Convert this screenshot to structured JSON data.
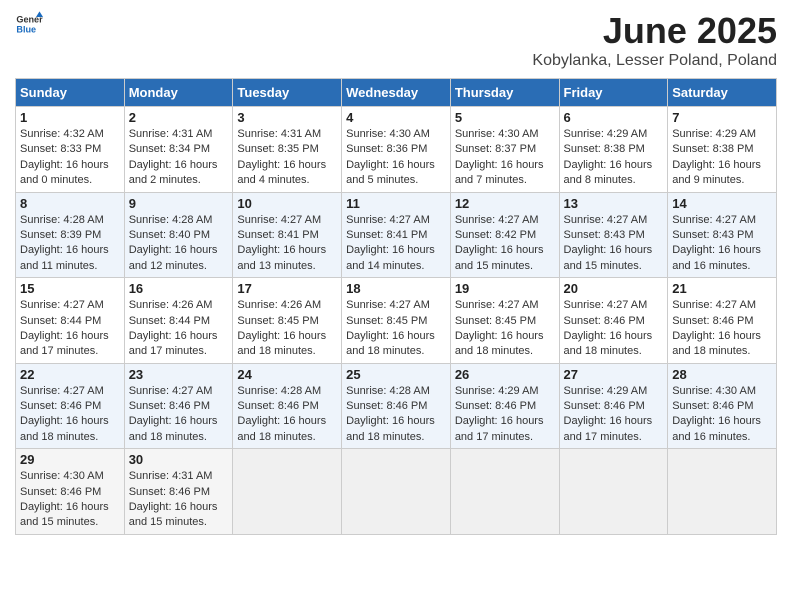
{
  "logo": {
    "general": "General",
    "blue": "Blue"
  },
  "title": "June 2025",
  "location": "Kobylanka, Lesser Poland, Poland",
  "weekdays": [
    "Sunday",
    "Monday",
    "Tuesday",
    "Wednesday",
    "Thursday",
    "Friday",
    "Saturday"
  ],
  "weeks": [
    [
      {
        "day": 1,
        "sunrise": "4:32 AM",
        "sunset": "8:33 PM",
        "daylight": "16 hours and 0 minutes."
      },
      {
        "day": 2,
        "sunrise": "4:31 AM",
        "sunset": "8:34 PM",
        "daylight": "16 hours and 2 minutes."
      },
      {
        "day": 3,
        "sunrise": "4:31 AM",
        "sunset": "8:35 PM",
        "daylight": "16 hours and 4 minutes."
      },
      {
        "day": 4,
        "sunrise": "4:30 AM",
        "sunset": "8:36 PM",
        "daylight": "16 hours and 5 minutes."
      },
      {
        "day": 5,
        "sunrise": "4:30 AM",
        "sunset": "8:37 PM",
        "daylight": "16 hours and 7 minutes."
      },
      {
        "day": 6,
        "sunrise": "4:29 AM",
        "sunset": "8:38 PM",
        "daylight": "16 hours and 8 minutes."
      },
      {
        "day": 7,
        "sunrise": "4:29 AM",
        "sunset": "8:38 PM",
        "daylight": "16 hours and 9 minutes."
      }
    ],
    [
      {
        "day": 8,
        "sunrise": "4:28 AM",
        "sunset": "8:39 PM",
        "daylight": "16 hours and 11 minutes."
      },
      {
        "day": 9,
        "sunrise": "4:28 AM",
        "sunset": "8:40 PM",
        "daylight": "16 hours and 12 minutes."
      },
      {
        "day": 10,
        "sunrise": "4:27 AM",
        "sunset": "8:41 PM",
        "daylight": "16 hours and 13 minutes."
      },
      {
        "day": 11,
        "sunrise": "4:27 AM",
        "sunset": "8:41 PM",
        "daylight": "16 hours and 14 minutes."
      },
      {
        "day": 12,
        "sunrise": "4:27 AM",
        "sunset": "8:42 PM",
        "daylight": "16 hours and 15 minutes."
      },
      {
        "day": 13,
        "sunrise": "4:27 AM",
        "sunset": "8:43 PM",
        "daylight": "16 hours and 15 minutes."
      },
      {
        "day": 14,
        "sunrise": "4:27 AM",
        "sunset": "8:43 PM",
        "daylight": "16 hours and 16 minutes."
      }
    ],
    [
      {
        "day": 15,
        "sunrise": "4:27 AM",
        "sunset": "8:44 PM",
        "daylight": "16 hours and 17 minutes."
      },
      {
        "day": 16,
        "sunrise": "4:26 AM",
        "sunset": "8:44 PM",
        "daylight": "16 hours and 17 minutes."
      },
      {
        "day": 17,
        "sunrise": "4:26 AM",
        "sunset": "8:45 PM",
        "daylight": "16 hours and 18 minutes."
      },
      {
        "day": 18,
        "sunrise": "4:27 AM",
        "sunset": "8:45 PM",
        "daylight": "16 hours and 18 minutes."
      },
      {
        "day": 19,
        "sunrise": "4:27 AM",
        "sunset": "8:45 PM",
        "daylight": "16 hours and 18 minutes."
      },
      {
        "day": 20,
        "sunrise": "4:27 AM",
        "sunset": "8:46 PM",
        "daylight": "16 hours and 18 minutes."
      },
      {
        "day": 21,
        "sunrise": "4:27 AM",
        "sunset": "8:46 PM",
        "daylight": "16 hours and 18 minutes."
      }
    ],
    [
      {
        "day": 22,
        "sunrise": "4:27 AM",
        "sunset": "8:46 PM",
        "daylight": "16 hours and 18 minutes."
      },
      {
        "day": 23,
        "sunrise": "4:27 AM",
        "sunset": "8:46 PM",
        "daylight": "16 hours and 18 minutes."
      },
      {
        "day": 24,
        "sunrise": "4:28 AM",
        "sunset": "8:46 PM",
        "daylight": "16 hours and 18 minutes."
      },
      {
        "day": 25,
        "sunrise": "4:28 AM",
        "sunset": "8:46 PM",
        "daylight": "16 hours and 18 minutes."
      },
      {
        "day": 26,
        "sunrise": "4:29 AM",
        "sunset": "8:46 PM",
        "daylight": "16 hours and 17 minutes."
      },
      {
        "day": 27,
        "sunrise": "4:29 AM",
        "sunset": "8:46 PM",
        "daylight": "16 hours and 17 minutes."
      },
      {
        "day": 28,
        "sunrise": "4:30 AM",
        "sunset": "8:46 PM",
        "daylight": "16 hours and 16 minutes."
      }
    ],
    [
      {
        "day": 29,
        "sunrise": "4:30 AM",
        "sunset": "8:46 PM",
        "daylight": "16 hours and 15 minutes."
      },
      {
        "day": 30,
        "sunrise": "4:31 AM",
        "sunset": "8:46 PM",
        "daylight": "16 hours and 15 minutes."
      },
      null,
      null,
      null,
      null,
      null
    ]
  ],
  "labels": {
    "sunrise": "Sunrise:",
    "sunset": "Sunset:",
    "daylight": "Daylight:"
  }
}
